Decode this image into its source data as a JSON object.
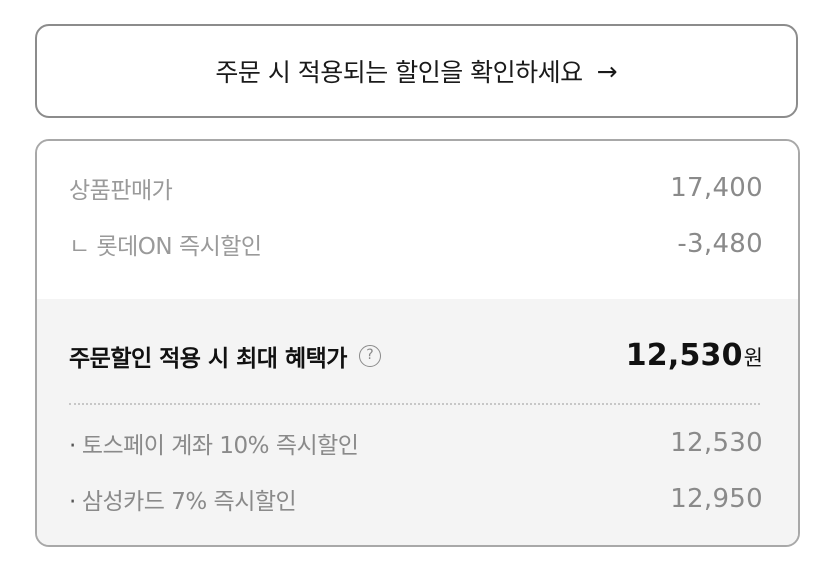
{
  "cta": {
    "label": "주문 시 적용되는 할인을 확인하세요",
    "arrow": "→"
  },
  "price_summary": {
    "list_price_label": "상품판매가",
    "list_price_value": "17,400",
    "instant_discount_label": "ㄴ 롯데ON 즉시할인",
    "instant_discount_value": "-3,480"
  },
  "max_benefit": {
    "label": "주문할인 적용 시 최대 혜택가",
    "help_glyph": "?",
    "value": "12,530",
    "unit": "원"
  },
  "card_discounts": [
    {
      "bullet": "·",
      "label": "토스페이 계좌 10% 즉시할인",
      "value": "12,530"
    },
    {
      "bullet": "·",
      "label": "삼성카드 7% 즉시할인",
      "value": "12,950"
    }
  ]
}
